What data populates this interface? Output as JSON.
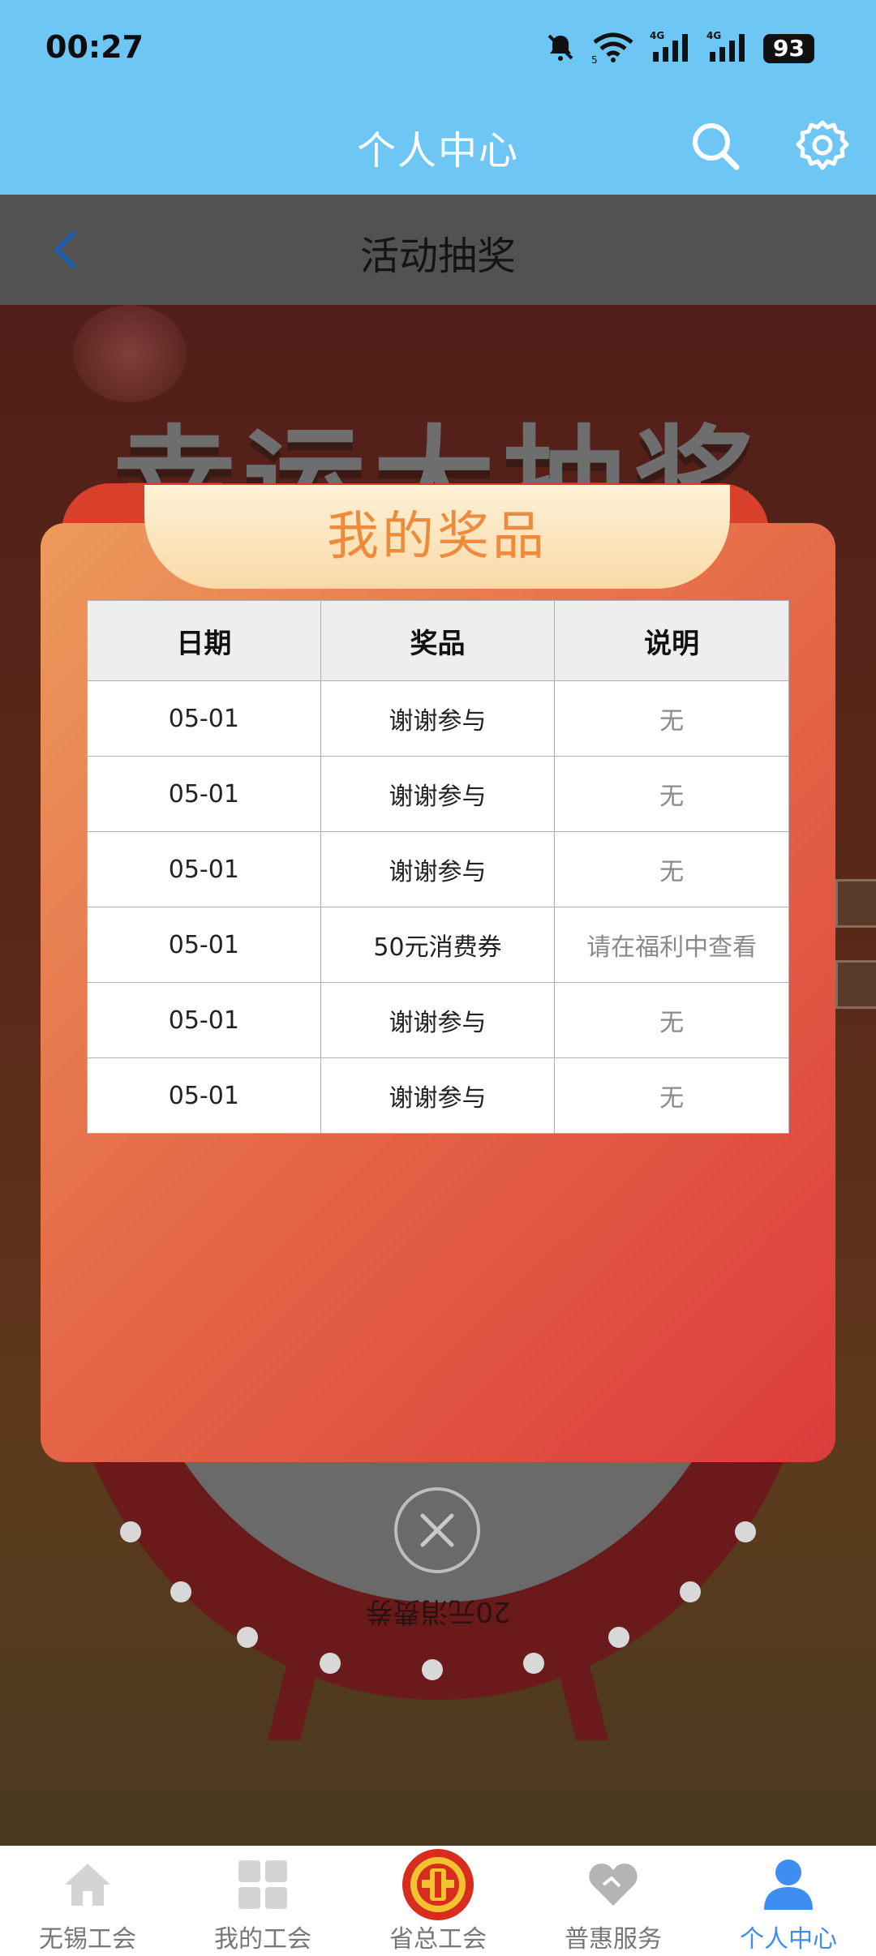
{
  "status_bar": {
    "time": "00:27",
    "network_1": "4G",
    "network_2": "4G",
    "battery": "93"
  },
  "header": {
    "title": "个人中心",
    "icons": [
      "search-icon",
      "settings-icon"
    ]
  },
  "page": {
    "title": "活动抽奖"
  },
  "background": {
    "title": "幸运大抽奖",
    "wheel_prize_text": "20元消费券"
  },
  "modal": {
    "title": "我的奖品",
    "columns": [
      "日期",
      "奖品",
      "说明"
    ],
    "rows": [
      {
        "date": "05-01",
        "prize": "谢谢参与",
        "desc": "无"
      },
      {
        "date": "05-01",
        "prize": "谢谢参与",
        "desc": "无"
      },
      {
        "date": "05-01",
        "prize": "谢谢参与",
        "desc": "无"
      },
      {
        "date": "05-01",
        "prize": "50元消费券",
        "desc": "请在福利中查看"
      },
      {
        "date": "05-01",
        "prize": "谢谢参与",
        "desc": "无"
      },
      {
        "date": "05-01",
        "prize": "谢谢参与",
        "desc": "无"
      }
    ]
  },
  "bottom_nav": {
    "items": [
      {
        "label": "无锡工会",
        "icon": "home-icon"
      },
      {
        "label": "我的工会",
        "icon": "grid-icon"
      },
      {
        "label": "省总工会",
        "icon": "union-logo-icon"
      },
      {
        "label": "普惠服务",
        "icon": "heart-icon"
      },
      {
        "label": "个人中心",
        "icon": "person-icon"
      }
    ],
    "active_index": 4,
    "active_color": "#3d8ef0"
  },
  "colors": {
    "header_bg": "#6ec6f5",
    "modal_gradient_start": "#ec9a5c",
    "modal_gradient_end": "#dc3c3c",
    "modal_title": "#ec8b3c"
  }
}
